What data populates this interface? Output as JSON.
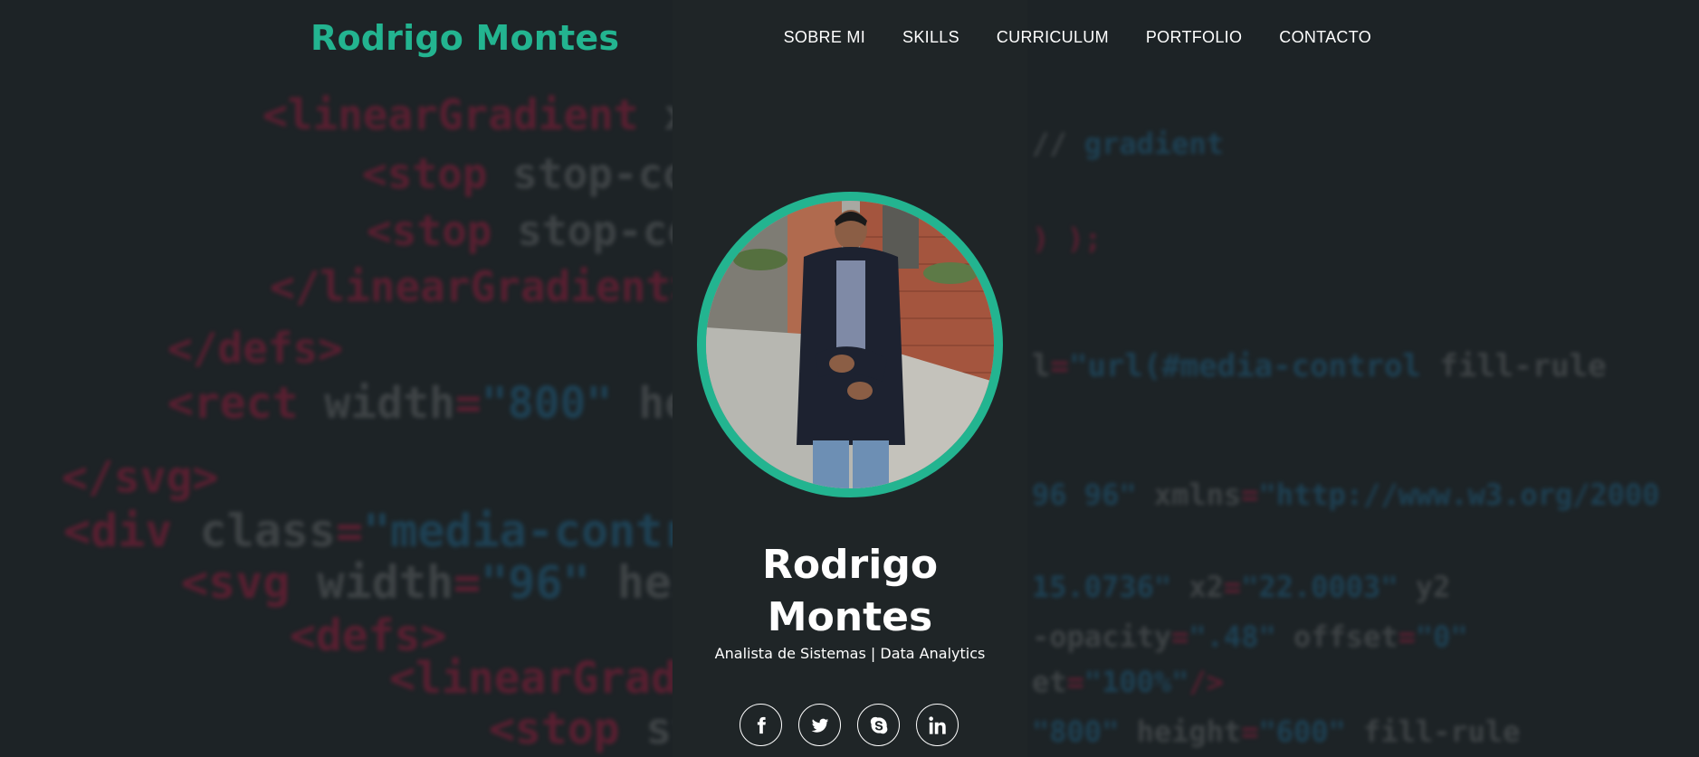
{
  "header": {
    "logo": "Rodrigo Montes",
    "nav": [
      "SOBRE MI",
      "SKILLS",
      "CURRICULUM",
      "PORTFOLIO",
      "CONTACTO"
    ]
  },
  "profile": {
    "name_line1": "Rodrigo",
    "name_line2": "Montes",
    "subtitle": "Analista de Sistemas | Data Analytics"
  },
  "socials": [
    "facebook-icon",
    "twitter-icon",
    "skype-icon",
    "linkedin-icon"
  ],
  "colors": {
    "accent": "#23b490",
    "background": "#1d2326"
  }
}
